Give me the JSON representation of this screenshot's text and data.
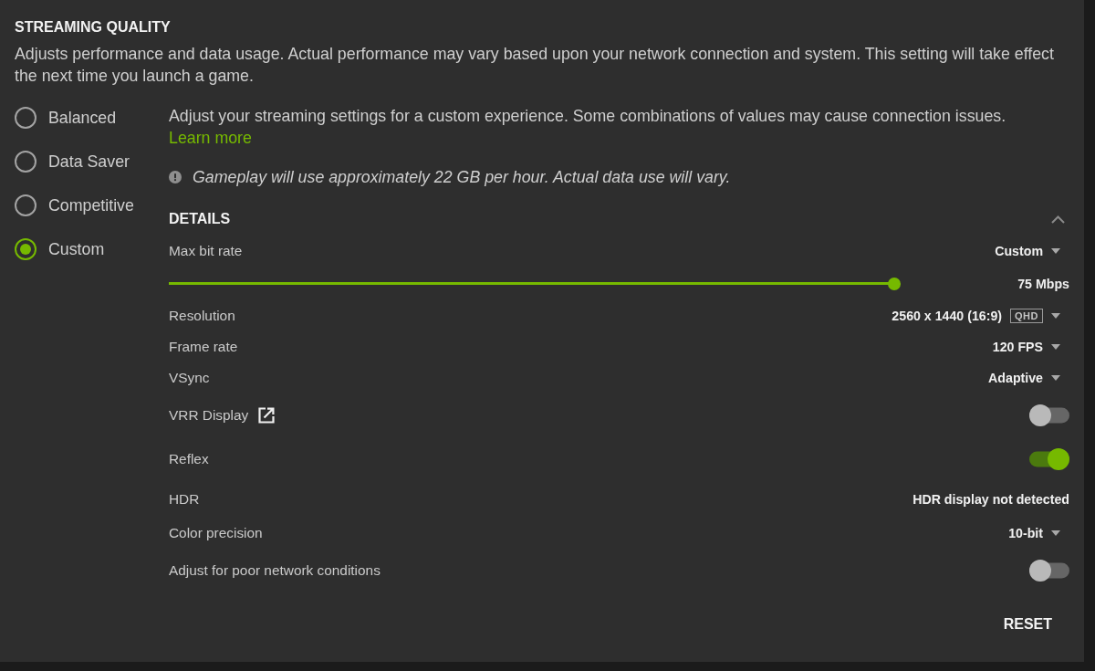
{
  "section": {
    "title": "STREAMING QUALITY",
    "description": "Adjusts performance and data usage. Actual performance may vary based upon your network connection and system. This setting will take effect the next time you launch a game."
  },
  "presets": [
    {
      "label": "Balanced",
      "selected": false
    },
    {
      "label": "Data Saver",
      "selected": false
    },
    {
      "label": "Competitive",
      "selected": false
    },
    {
      "label": "Custom",
      "selected": true
    }
  ],
  "custom": {
    "intro": "Adjust your streaming settings for a custom experience. Some combinations of values may cause connection issues.",
    "link": "Learn more",
    "notice": "Gameplay will use approximately 22 GB per hour. Actual data use will vary."
  },
  "details": {
    "title": "DETAILS",
    "expanded": true,
    "settings": [
      {
        "kind": "dropdown",
        "label": "Max bit rate",
        "value": "Custom"
      },
      {
        "kind": "slider",
        "level": 1,
        "reading": "75 Mbps"
      },
      {
        "kind": "dropdown",
        "label": "Resolution",
        "value": "2560 x 1440 (16:9)",
        "badge": "QHD"
      },
      {
        "kind": "dropdown",
        "label": "Frame rate",
        "value": "120 FPS"
      },
      {
        "kind": "dropdown",
        "label": "VSync",
        "value": "Adaptive"
      },
      {
        "kind": "toggle",
        "label": "VRR Display",
        "external_link": true,
        "on": false
      },
      {
        "kind": "toggle",
        "label": "Reflex",
        "on": true
      },
      {
        "kind": "text",
        "label": "HDR",
        "value": "HDR display not detected"
      },
      {
        "kind": "dropdown",
        "label": "Color precision",
        "value": "10-bit"
      },
      {
        "kind": "toggle",
        "label": "Adjust for poor network conditions",
        "on": false
      }
    ]
  },
  "reset": "RESET"
}
